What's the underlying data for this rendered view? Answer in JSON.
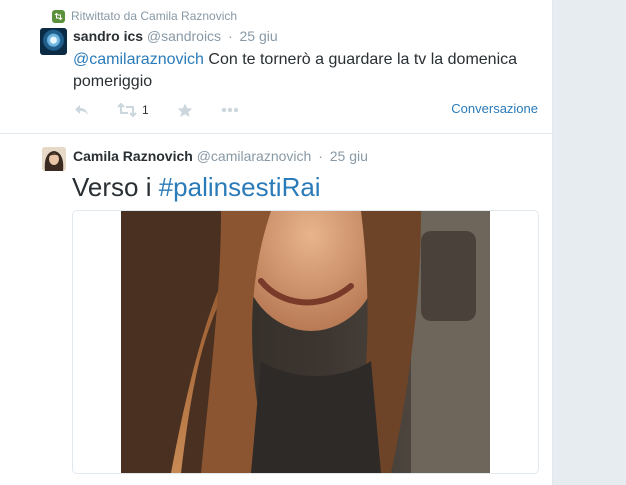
{
  "tweet1": {
    "retweet_context": "Ritwittato da Camila Raznovich",
    "fullname": "sandro ics",
    "screen_name": "@sandroics",
    "separator": "·",
    "time": "25 giu",
    "text_mention": "@camilaraznovich",
    "text_body": " Con te tornerò a guardare la tv la domenica pomeriggio",
    "retweet_count": "1",
    "conversation_link": "Conversazione"
  },
  "tweet2": {
    "fullname": "Camila Raznovich",
    "screen_name": "@camilaraznovich",
    "separator": "·",
    "time": "25 giu",
    "text_prefix": "Verso i ",
    "text_hashtag": "#palinsestiRai"
  },
  "icons": {
    "retweet_context": "retweet-icon",
    "reply": "reply-icon",
    "retweet": "retweet-icon",
    "favorite": "star-icon",
    "more": "more-icon"
  },
  "colors": {
    "link": "#2b7bb9",
    "muted": "#8899a6",
    "action_icon": "#ccd6dd",
    "retweet_green": "#5c913b",
    "text": "#292f33",
    "border": "#e1e8ed",
    "page_bg": "#e6ecf0"
  }
}
